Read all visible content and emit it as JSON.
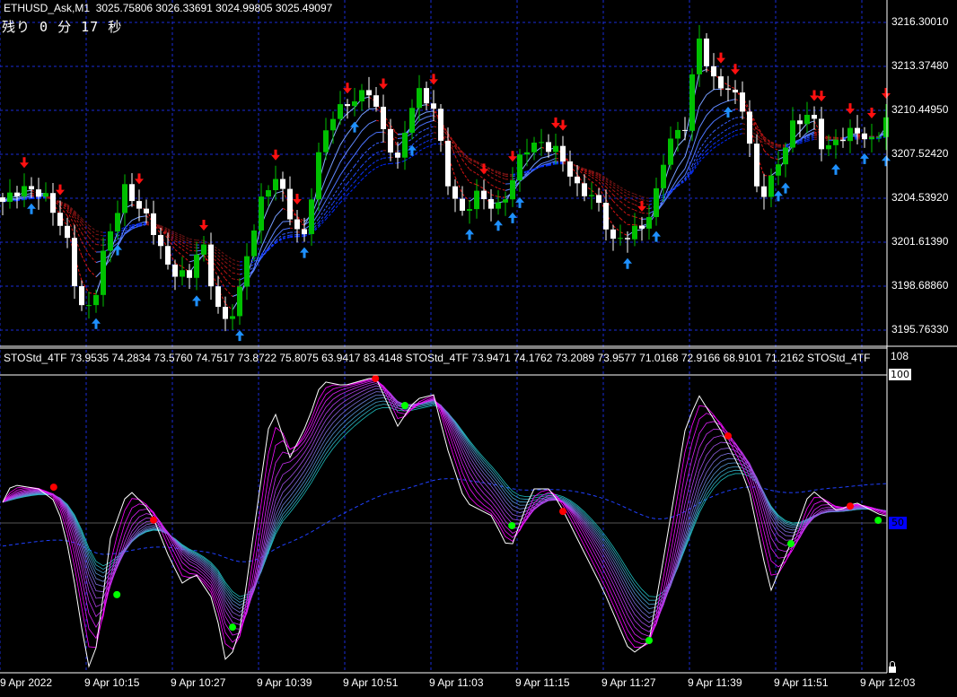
{
  "header": {
    "symbol": "ETHUSD_Ask,M1",
    "ohlc": "3025.75806 3026.33691 3024.99805 3025.49097",
    "timer": "残り 0 分 17 秒"
  },
  "price_axis": [
    "3216.30010",
    "3213.37480",
    "3210.44950",
    "3207.52420",
    "3204.53920",
    "3201.61390",
    "3198.68860",
    "3195.76330"
  ],
  "time_axis": [
    "9 Apr 2022",
    "9 Apr 10:15",
    "9 Apr 10:27",
    "9 Apr 10:39",
    "9 Apr 10:51",
    "9 Apr 11:03",
    "9 Apr 11:15",
    "9 Apr 11:27",
    "9 Apr 11:39",
    "9 Apr 11:51",
    "9 Apr 12:03"
  ],
  "indicator": {
    "header": "STOStd_4TF 73.9535 74.2834 73.5760 74.7517 73.8722 75.8075 63.9417 83.4148  STOStd_4TF 73.9471 74.1762 73.2089 73.9577 71.0168 72.9166 68.9101 71.2162  STOStd_4TF",
    "scale_max": "108",
    "level_100": "100",
    "level_50": "50"
  },
  "colors": {
    "bull": "#00c000",
    "bear": "#ffffff",
    "grid": "#1a2bd8",
    "ribbon_up": "#4a8cff",
    "ribbon_down": "#ff2020",
    "osc_fast": "#ff00ff",
    "osc_slow": "#20c0c0",
    "arrow_up": "#1e90ff",
    "arrow_down": "#ff1010",
    "dot_red": "#ff0000",
    "dot_green": "#00ff00"
  },
  "chart_data": {
    "type": "candlestick",
    "price_keypoints": [
      [
        0,
        3204.29
      ],
      [
        2.5,
        3205.19
      ],
      [
        5.6,
        3204.89
      ],
      [
        8.75,
        3202.19
      ],
      [
        10.6,
        3197.38
      ],
      [
        12.5,
        3197.08
      ],
      [
        13.75,
        3200.39
      ],
      [
        16.9,
        3205.19
      ],
      [
        19.4,
        3203.69
      ],
      [
        21.25,
        3202.19
      ],
      [
        23.1,
        3199.79
      ],
      [
        26.25,
        3199.19
      ],
      [
        27.5,
        3202.19
      ],
      [
        29.4,
        3197.98
      ],
      [
        31.25,
        3195.88
      ],
      [
        33.1,
        3198.59
      ],
      [
        35.6,
        3203.99
      ],
      [
        38.1,
        3206.09
      ],
      [
        40,
        3203.39
      ],
      [
        41.9,
        3201.59
      ],
      [
        43.75,
        3206.99
      ],
      [
        45.6,
        3209.99
      ],
      [
        48.1,
        3210.89
      ],
      [
        51.25,
        3211.8
      ],
      [
        53.1,
        3208.79
      ],
      [
        55,
        3206.99
      ],
      [
        57.5,
        3211.8
      ],
      [
        60,
        3210.6
      ],
      [
        61.9,
        3205.79
      ],
      [
        63.75,
        3203.39
      ],
      [
        66.25,
        3204.89
      ],
      [
        68.75,
        3203.69
      ],
      [
        70.6,
        3205.19
      ],
      [
        72.5,
        3207.89
      ],
      [
        75,
        3208.19
      ],
      [
        77.5,
        3207.59
      ],
      [
        80,
        3205.19
      ],
      [
        82.5,
        3204.59
      ],
      [
        85,
        3201.59
      ],
      [
        87.5,
        3202.19
      ],
      [
        89.4,
        3202.79
      ],
      [
        90.6,
        3203.99
      ],
      [
        92.5,
        3208.19
      ],
      [
        95,
        3209.39
      ],
      [
        96.9,
        3215.4
      ],
      [
        98.75,
        3212.4
      ],
      [
        101.25,
        3211.8
      ],
      [
        103.1,
        3210.6
      ],
      [
        105,
        3205.19
      ],
      [
        106.25,
        3204.89
      ],
      [
        108.1,
        3206.99
      ],
      [
        110,
        3209.39
      ],
      [
        112.5,
        3210.3
      ],
      [
        114.4,
        3207.59
      ],
      [
        116.25,
        3208.49
      ],
      [
        118.75,
        3209.09
      ],
      [
        121.25,
        3208.19
      ],
      [
        123.1,
        3209.99
      ]
    ],
    "down_arrows": [
      3,
      8,
      19,
      28,
      38,
      41,
      48,
      53,
      60,
      67,
      71,
      77,
      78,
      89,
      100,
      102,
      113,
      114,
      118,
      121,
      123
    ],
    "up_arrows": [
      4,
      13,
      16,
      27,
      33,
      42,
      49,
      57,
      65,
      69,
      71,
      72,
      87,
      91,
      101,
      108,
      109,
      116,
      120,
      123
    ],
    "oscillator": {
      "ylim": [
        0,
        100
      ],
      "fast_keypoints": [
        [
          0,
          57
        ],
        [
          1.25,
          63
        ],
        [
          5,
          61.5
        ],
        [
          7.5,
          57
        ],
        [
          9.4,
          38.8
        ],
        [
          11.9,
          0.9
        ],
        [
          13.1,
          8.5
        ],
        [
          15,
          44.8
        ],
        [
          17.5,
          61.5
        ],
        [
          20.6,
          53.9
        ],
        [
          23.1,
          38.8
        ],
        [
          25,
          29.7
        ],
        [
          26.9,
          32.7
        ],
        [
          29.4,
          23.6
        ],
        [
          31.25,
          0.9
        ],
        [
          33.1,
          14.5
        ],
        [
          35,
          47.9
        ],
        [
          37.5,
          90.3
        ],
        [
          40,
          72.1
        ],
        [
          42.5,
          84.2
        ],
        [
          44.4,
          97.9
        ],
        [
          47.5,
          96.4
        ],
        [
          51.9,
          99.4
        ],
        [
          55,
          82.7
        ],
        [
          57.5,
          91.8
        ],
        [
          60,
          93.3
        ],
        [
          61.9,
          75.2
        ],
        [
          64.4,
          57
        ],
        [
          68.1,
          52.4
        ],
        [
          70.6,
          40.3
        ],
        [
          73.75,
          61.5
        ],
        [
          76.25,
          61.5
        ],
        [
          78.1,
          53.9
        ],
        [
          80.6,
          41.8
        ],
        [
          83.75,
          26.7
        ],
        [
          87.5,
          5.5
        ],
        [
          90,
          10
        ],
        [
          92.5,
          44.8
        ],
        [
          95,
          81.2
        ],
        [
          96.9,
          93.3
        ],
        [
          100,
          81.2
        ],
        [
          103.75,
          63
        ],
        [
          106.9,
          26.7
        ],
        [
          110,
          44.8
        ],
        [
          112.5,
          61.5
        ],
        [
          116.25,
          53.9
        ],
        [
          118.75,
          57
        ],
        [
          122.5,
          52.4
        ]
      ],
      "signal_dots": [
        [
          7.1,
          62.1,
          "red"
        ],
        [
          21,
          51,
          "red"
        ],
        [
          15.9,
          25.8,
          "green"
        ],
        [
          32,
          14.8,
          "green"
        ],
        [
          51.9,
          98.8,
          "red"
        ],
        [
          56,
          89.7,
          "green"
        ],
        [
          70.9,
          49.1,
          "green"
        ],
        [
          78,
          53.9,
          "red"
        ],
        [
          90,
          10.3,
          "green"
        ],
        [
          101,
          79.4,
          "red"
        ],
        [
          109.75,
          43,
          "green"
        ],
        [
          118,
          55.7,
          "red"
        ],
        [
          121.9,
          50.9,
          "green"
        ]
      ]
    }
  }
}
